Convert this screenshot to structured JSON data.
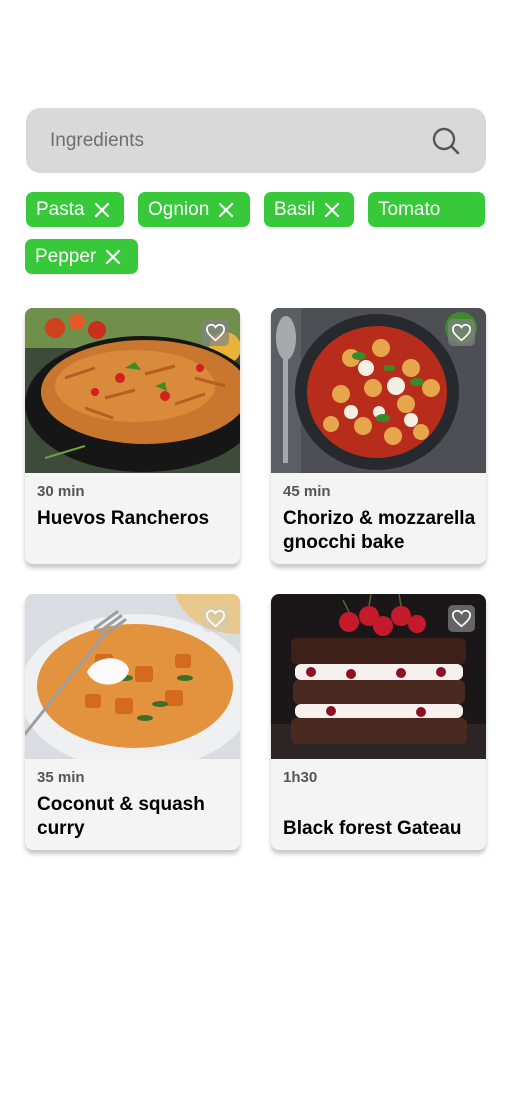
{
  "search": {
    "placeholder": "Ingredients",
    "value": ""
  },
  "chips": [
    {
      "label": "Pasta"
    },
    {
      "label": "Ognion"
    },
    {
      "label": "Basil"
    },
    {
      "label": "Tomato"
    },
    {
      "label": "Pepper"
    }
  ],
  "recipes": [
    {
      "time": "30 min",
      "title": "Huevos Rancheros"
    },
    {
      "time": "45 min",
      "title": "Chorizo & mozzarella gnocchi bake"
    },
    {
      "time": "35 min",
      "title": "Coconut & squash curry"
    },
    {
      "time": "1h30",
      "title": "Black forest Gateau"
    }
  ],
  "colors": {
    "chip": "#37c93a",
    "search_bg": "#d9d9d9",
    "card_bg": "#f4f4f4"
  }
}
